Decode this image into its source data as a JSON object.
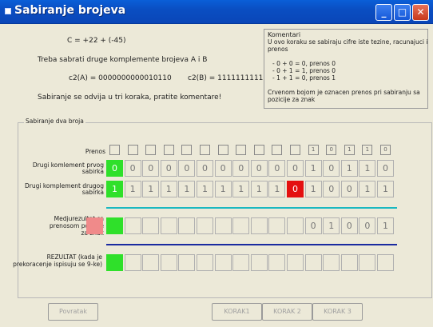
{
  "window": {
    "title": "Sabiranje brojeva"
  },
  "intro": {
    "equation": "C = +22  +  (-45)",
    "instruction": "Treba sabrati druge komplemente brojeva A i B",
    "complement_a": "c2(A) = 0000000000010110",
    "complement_b": "c2(B) = 1111111111010011",
    "steps_note": "Sabiranje se odvija u tri koraka, pratite komentare!"
  },
  "komentar": {
    "title": "Komentari",
    "lines": [
      "U ovo koraku se sabiraju cifre iste tezine, racunajuci i",
      "prenos",
      "",
      "- 0 + 0 = 0, prenos 0",
      "- 0 + 1 = 1, prenos 0",
      "- 1 + 1 = 0, prenos 1",
      "",
      "Crvenom bojom je oznacen prenos pri sabiranju sa",
      "pozicije za znak"
    ]
  },
  "group": {
    "title": "Sabiranje dva broja",
    "carry_label": "Prenos",
    "carry": [
      "",
      "",
      "",
      "",
      "",
      "",
      "",
      "",
      "",
      "",
      "",
      "1",
      "0",
      "1",
      "1",
      "0"
    ],
    "row1_label_1": "Drugi komlement prvog",
    "row1_label_2": "sabirka",
    "row1": [
      "0",
      "0",
      "0",
      "0",
      "0",
      "0",
      "0",
      "0",
      "0",
      "0",
      "0",
      "1",
      "0",
      "1",
      "1",
      "0"
    ],
    "row2_label_1": "Drugi komplement drugog",
    "row2_label_2": "sabirka",
    "row2": [
      "1",
      "1",
      "1",
      "1",
      "1",
      "1",
      "1",
      "1",
      "1",
      "1",
      "0",
      "1",
      "0",
      "0",
      "1",
      "1"
    ],
    "intermediate_label_1": "Medjurezultat sa",
    "intermediate_label_2": "prenosom pozicije",
    "intermediate_label_3": "za znak",
    "intermediate": [
      "",
      "",
      "",
      "",
      "",
      "",
      "",
      "",
      "",
      "",
      "",
      "0",
      "1",
      "0",
      "0",
      "1"
    ],
    "result_label_1": "REZULTAT (kada je",
    "result_label_2": "prekoracenje ispisuju se 9-ke)",
    "result": [
      "",
      "",
      "",
      "",
      "",
      "",
      "",
      "",
      "",
      "",
      "",
      "",
      "",
      "",
      "",
      ""
    ]
  },
  "buttons": {
    "back": "Povratak",
    "step1": "KORAK1",
    "step2": "KORAK 2",
    "step3": "KORAK 3"
  },
  "colors": {
    "highlight_green": "#2fe02a",
    "carry_red": "#e41010",
    "teal_line": "#1ab8c0",
    "blue_line": "#1a2aa0"
  }
}
